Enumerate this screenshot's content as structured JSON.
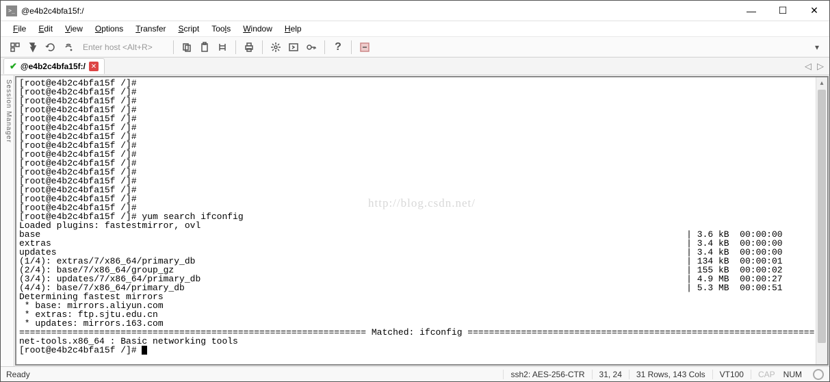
{
  "title": "@e4b2c4bfa15f:/",
  "menu": [
    "File",
    "Edit",
    "View",
    "Options",
    "Transfer",
    "Script",
    "Tools",
    "Window",
    "Help"
  ],
  "host_placeholder": "Enter host <Alt+R>",
  "tab": {
    "label": "@e4b2c4bfa15f:/"
  },
  "sidebar": "Session Manager",
  "watermark": "http://blog.csdn.net/",
  "terminal": {
    "prompts": "[root@e4b2c4bfa15f /]#\n[root@e4b2c4bfa15f /]#\n[root@e4b2c4bfa15f /]#\n[root@e4b2c4bfa15f /]#\n[root@e4b2c4bfa15f /]#\n[root@e4b2c4bfa15f /]#\n[root@e4b2c4bfa15f /]#\n[root@e4b2c4bfa15f /]#\n[root@e4b2c4bfa15f /]#\n[root@e4b2c4bfa15f /]#\n[root@e4b2c4bfa15f /]#\n[root@e4b2c4bfa15f /]#\n[root@e4b2c4bfa15f /]#\n[root@e4b2c4bfa15f /]#\n[root@e4b2c4bfa15f /]#\n[root@e4b2c4bfa15f /]# yum search ifconfig\nLoaded plugins: fastestmirror, ovl",
    "rows": [
      {
        "l": "base",
        "r": "| 3.6 kB  00:00:00"
      },
      {
        "l": "extras",
        "r": "| 3.4 kB  00:00:00"
      },
      {
        "l": "updates",
        "r": "| 3.4 kB  00:00:00"
      },
      {
        "l": "(1/4): extras/7/x86_64/primary_db",
        "r": "| 134 kB  00:00:01"
      },
      {
        "l": "(2/4): base/7/x86_64/group_gz",
        "r": "| 155 kB  00:00:02"
      },
      {
        "l": "(3/4): updates/7/x86_64/primary_db",
        "r": "| 4.9 MB  00:00:27"
      },
      {
        "l": "(4/4): base/7/x86_64/primary_db",
        "r": "| 5.3 MB  00:00:51"
      }
    ],
    "tail": "Determining fastest mirrors\n * base: mirrors.aliyun.com\n * extras: ftp.sjtu.edu.cn\n * updates: mirrors.163.com\n================================================================= Matched: ifconfig =================================================================\nnet-tools.x86_64 : Basic networking tools\n[root@e4b2c4bfa15f /]# "
  },
  "status": {
    "ready": "Ready",
    "cipher": "ssh2: AES-256-CTR",
    "pos": "31, 24",
    "size": "31 Rows, 143 Cols",
    "term": "VT100",
    "cap": "CAP",
    "num": "NUM"
  }
}
